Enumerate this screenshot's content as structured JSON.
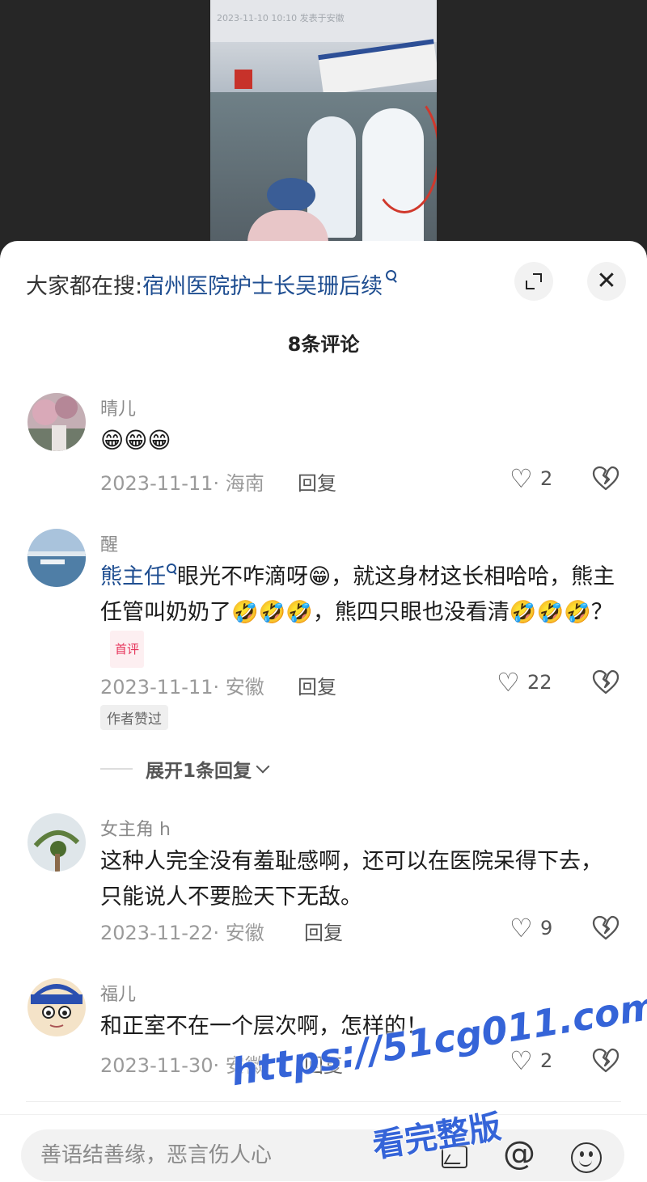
{
  "video": {
    "caption": "2023-11-10 10:10  发表于安徽"
  },
  "search": {
    "prefix": "大家都在搜:",
    "keyword": "宿州医院护士长吴珊后续"
  },
  "comments_header": {
    "count_label": "8条评论"
  },
  "comments": [
    {
      "name": "晴儿",
      "text": "😁😁😁",
      "date_location": "2023-11-11· 海南",
      "reply_label": "回复",
      "likes": "2"
    },
    {
      "name": "醒",
      "mention": "熊主任",
      "text_1": "眼光不咋滴呀😁，就这身材这长相哈哈，熊主任管叫奶奶了🤣🤣🤣，熊四只眼也没看清🤣🤣🤣？",
      "badge": "首评",
      "date_location": "2023-11-11· 安徽",
      "reply_label": "回复",
      "likes": "22",
      "author_badge": "作者赞过",
      "expand_replies": "展开1条回复"
    },
    {
      "name": "女主角 h",
      "text": "这种人完全没有羞耻感啊，还可以在医院呆得下去，只能说人不要脸天下无敌。",
      "date_location": "2023-11-22· 安徽",
      "reply_label": "回复",
      "likes": "9"
    },
    {
      "name": "福儿",
      "text": "和正室不在一个层次啊，怎样的！",
      "date_location": "2023-11-30· 安徽",
      "reply_label": "回复",
      "likes": "2"
    }
  ],
  "input": {
    "placeholder": "善语结善缘，恶言伤人心"
  },
  "watermark": {
    "line1": "https://51cg011.com",
    "line2": "看完整版"
  },
  "colors": {
    "link_blue": "#1f4e91",
    "badge_red": "#e6335a",
    "watermark_blue": "#3564d8"
  }
}
